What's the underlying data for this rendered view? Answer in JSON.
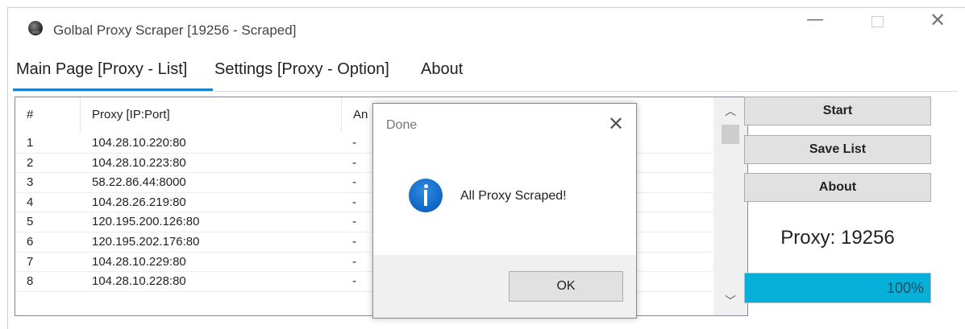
{
  "window": {
    "title": "Golbal Proxy Scraper [19256 - Scraped]",
    "icon": "app-globe-icon"
  },
  "tabs": [
    {
      "label": "Main Page [Proxy - List]",
      "active": true
    },
    {
      "label": "Settings [Proxy - Option]",
      "active": false
    },
    {
      "label": "About",
      "active": false
    }
  ],
  "table": {
    "columns": [
      "#",
      "Proxy [IP:Port]",
      "An"
    ],
    "rows": [
      {
        "num": "1",
        "proxy": "104.28.10.220:80",
        "anon": "-"
      },
      {
        "num": "2",
        "proxy": "104.28.10.223:80",
        "anon": "-"
      },
      {
        "num": "3",
        "proxy": "58.22.86.44:8000",
        "anon": "-"
      },
      {
        "num": "4",
        "proxy": "104.28.26.219:80",
        "anon": "-"
      },
      {
        "num": "5",
        "proxy": "120.195.200.126:80",
        "anon": "-"
      },
      {
        "num": "6",
        "proxy": "120.195.202.176:80",
        "anon": "-"
      },
      {
        "num": "7",
        "proxy": "104.28.10.229:80",
        "anon": "-"
      },
      {
        "num": "8",
        "proxy": "104.28.10.228:80",
        "anon": "-"
      }
    ]
  },
  "side": {
    "start_label": "Start",
    "save_label": "Save List",
    "about_label": "About",
    "proxy_count_text": "Proxy: 19256",
    "progress_percent": 100,
    "progress_text": "100%"
  },
  "dialog": {
    "title": "Done",
    "message": "All Proxy Scraped!",
    "ok_label": "OK",
    "icon": "info-icon"
  },
  "colors": {
    "accent": "#1a84c8",
    "progress": "#06b0d8"
  }
}
